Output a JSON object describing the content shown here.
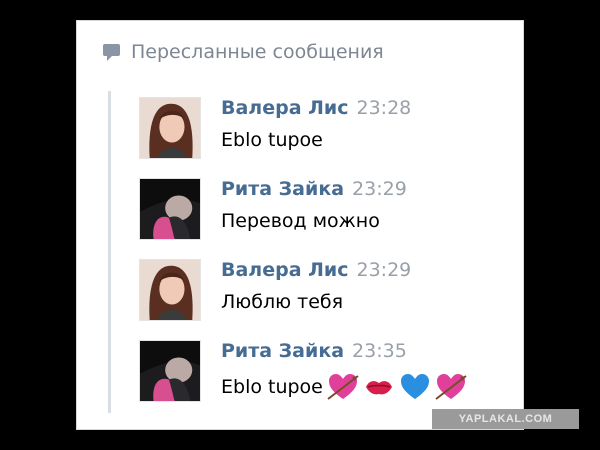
{
  "forwarded": {
    "title": "Пересланные сообщения",
    "icon": "chat-bubble-icon"
  },
  "messages": [
    {
      "author": "Валера Лис",
      "time": "23:28",
      "text": "Eblo tupoe",
      "avatar": "avatar-girl-light"
    },
    {
      "author": "Рита Зайка",
      "time": "23:29",
      "text": "Перевод можно",
      "avatar": "avatar-girl-dark"
    },
    {
      "author": "Валера Лис",
      "time": "23:29",
      "text": "Люблю тебя",
      "avatar": "avatar-girl-light"
    },
    {
      "author": "Рита Зайка",
      "time": "23:35",
      "text": "Eblo tupoe",
      "avatar": "avatar-girl-dark",
      "emojis": [
        "heart-arrow-icon",
        "kiss-lips-icon",
        "blue-heart-icon",
        "heart-arrow-icon"
      ]
    }
  ],
  "watermark": "YAPLAKAL.COM",
  "colors": {
    "author": "#476c93",
    "time": "#9aa0a8",
    "title": "#7d8794",
    "rail": "#d9dee5"
  }
}
